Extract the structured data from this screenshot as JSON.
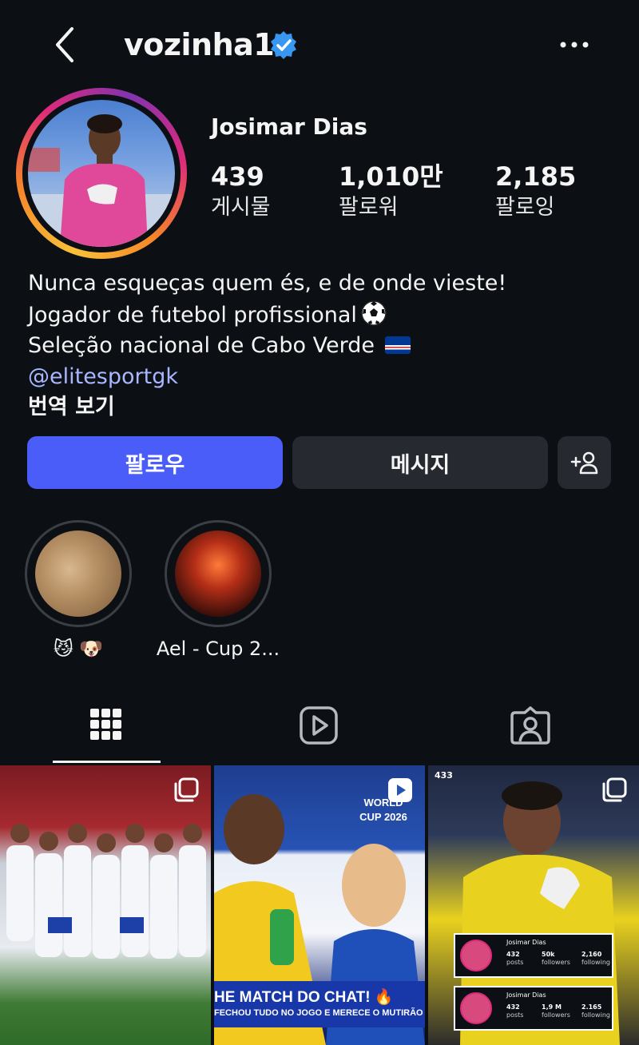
{
  "header": {
    "username": "vozinha1"
  },
  "profile": {
    "display_name": "Josimar Dias",
    "stats": [
      {
        "value": "439",
        "label": "게시물"
      },
      {
        "value": "1,010만",
        "label": "팔로워"
      },
      {
        "value": "2,185",
        "label": "팔로잉"
      }
    ],
    "bio": {
      "line1": "Nunca esqueças quem és, e de onde vieste!",
      "line2": "Jogador de futebol profissional",
      "line3": "Seleção nacional de Cabo Verde",
      "mention": "@elitesportgk",
      "translate": "번역 보기"
    }
  },
  "actions": {
    "follow": "팔로우",
    "message": "메시지"
  },
  "highlights": [
    {
      "label": "😼 🐶"
    },
    {
      "label": "Ael - Cup 2..."
    }
  ],
  "posts": {
    "post2_caption_1": "HE MATCH DO CHAT! 🔥",
    "post2_caption_2": "FECHOU TUDO NO JOGO E MERECE O MUTIRÃO",
    "post2_badge": "WORLD CUP 2026",
    "post3_tag": "433",
    "cards": [
      {
        "name": "Josimar Dias",
        "posts": "432",
        "followers": "50k",
        "following": "2,160",
        "posts_label": "posts",
        "followers_label": "followers",
        "following_label": "following"
      },
      {
        "name": "Josimar Dias",
        "posts": "432",
        "followers": "1,9 M",
        "following": "2.165",
        "posts_label": "posts",
        "followers_label": "followers",
        "following_label": "following"
      }
    ]
  },
  "colors": {
    "background": "#0c1014",
    "follow_button": "#4a5df9",
    "secondary_button": "#262a30",
    "link": "#a8b7ff",
    "verified": "#3897f0"
  },
  "icons": {
    "back": "chevron-left-icon",
    "verified": "verified-badge-icon",
    "more": "more-horizontal-icon",
    "add_user": "add-user-icon",
    "grid": "grid-icon",
    "reels": "reels-icon",
    "tagged": "tagged-icon",
    "multi": "multi-post-icon"
  }
}
